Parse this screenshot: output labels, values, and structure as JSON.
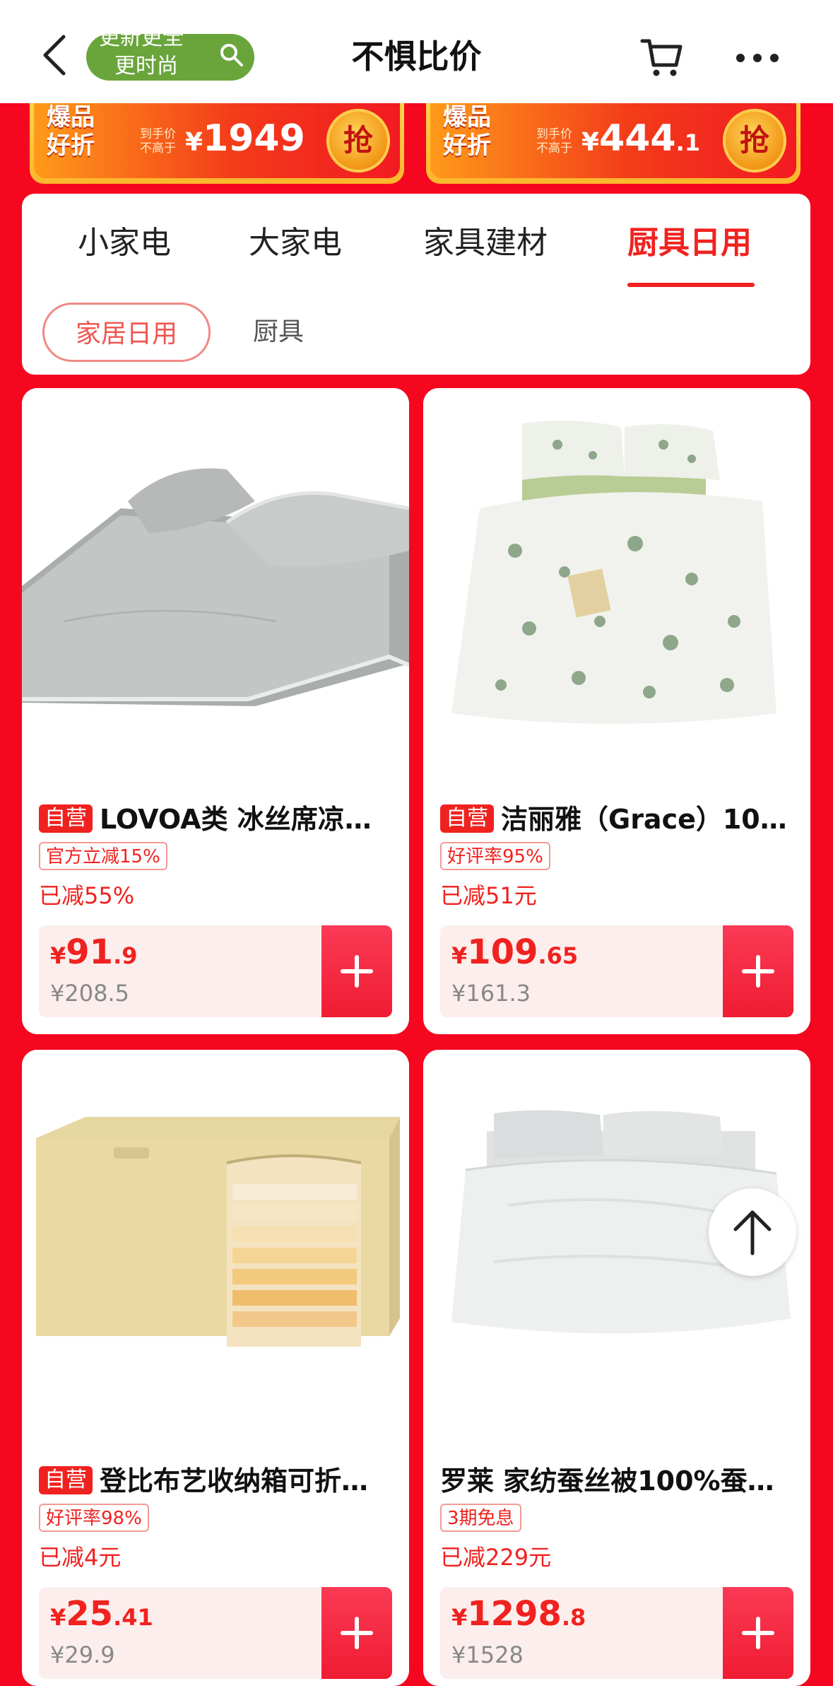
{
  "header": {
    "title": "不惧比价",
    "search_line1": "更新更全",
    "search_line2": "更时尚"
  },
  "promos": [
    {
      "tag_line1": "爆品",
      "tag_line2": "好折",
      "sub_line1": "到手价",
      "sub_line2": "不高于",
      "currency": "¥",
      "price_int": "1949",
      "price_dec": "",
      "grab": "抢"
    },
    {
      "tag_line1": "爆品",
      "tag_line2": "好折",
      "sub_line1": "到手价",
      "sub_line2": "不高于",
      "currency": "¥",
      "price_int": "444",
      "price_dec": ".1",
      "grab": "抢"
    }
  ],
  "tabs": [
    "小家电",
    "大家电",
    "家具建材",
    "厨具日用"
  ],
  "active_tab": "厨具日用",
  "chips": [
    "家居日用",
    "厨具"
  ],
  "products": [
    {
      "self_badge": "自营",
      "title": "LOVOA类 冰丝席凉…",
      "tag": "官方立减15%",
      "reduced": "已减55%",
      "currency": "¥",
      "price_int": "91",
      "price_dec": ".9",
      "price_was": "¥208.5"
    },
    {
      "self_badge": "自营",
      "title": "洁丽雅（Grace）10…",
      "tag": "好评率95%",
      "reduced": "已减51元",
      "currency": "¥",
      "price_int": "109",
      "price_dec": ".65",
      "price_was": "¥161.3"
    },
    {
      "self_badge": "自营",
      "title": "登比布艺收纳箱可折…",
      "tag": "好评率98%",
      "reduced": "已减4元",
      "currency": "¥",
      "price_int": "25",
      "price_dec": ".41",
      "price_was": "¥29.9"
    },
    {
      "self_badge": "",
      "title": "罗莱 家纺蚕丝被100%蚕…",
      "tag": "3期免息",
      "reduced": "已减229元",
      "currency": "¥",
      "price_int": "1298",
      "price_dec": ".8",
      "price_was": "¥1528"
    }
  ],
  "colors": {
    "accent": "#f0221f",
    "background": "#f5071f",
    "pill": "#6aa53c"
  },
  "icons": [
    "back-arrow-icon",
    "search-icon",
    "cart-icon",
    "more-icon",
    "plus-icon",
    "arrow-up-icon"
  ]
}
